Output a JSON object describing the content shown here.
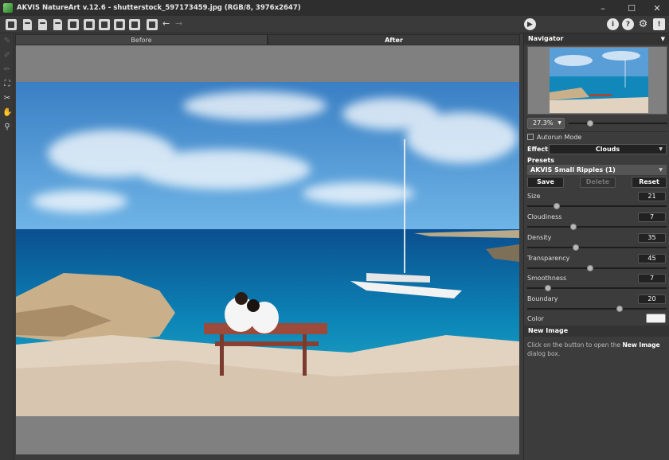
{
  "window": {
    "title": "AKVIS NatureArt v.12.6 - shutterstock_597173459.jpg (RGB/8, 3976x2647)",
    "controls": [
      "minimize",
      "maximize",
      "close"
    ]
  },
  "toolbar": {
    "icons": [
      "workspace-icon",
      "open-icon",
      "save-icon",
      "export-icon",
      "print-icon",
      "batch-icon",
      "plugin-icon",
      "brush-preset-icon",
      "apply-icon",
      "share-icon",
      "undo-icon",
      "redo-icon",
      "run-icon",
      "info-icon",
      "help-icon",
      "settings-icon",
      "notification-icon"
    ]
  },
  "tools": [
    "eraser-icon",
    "brush-icon",
    "pencil-icon",
    "crop-icon",
    "tube-icon",
    "hand-icon",
    "zoom-icon"
  ],
  "tabs": [
    {
      "label": "Before",
      "active": false
    },
    {
      "label": "After",
      "active": true
    }
  ],
  "navigator": {
    "title": "Navigator",
    "zoom": "27.3%",
    "zoom_level": 0.22
  },
  "settings": {
    "autorun_label": "Autorun Mode",
    "autorun_checked": false,
    "effect_label": "Effect:",
    "effect_value": "Clouds",
    "presets_label": "Presets",
    "preset_value": "AKVIS Small Ripples (1)",
    "save_label": "Save",
    "delete_label": "Delete",
    "reset_label": "Reset",
    "params": [
      {
        "label": "Size",
        "value": "21",
        "level": 0.21
      },
      {
        "label": "Cloudiness",
        "value": "7",
        "level": 0.33
      },
      {
        "label": "Density",
        "value": "35",
        "level": 0.35
      },
      {
        "label": "Transparency",
        "value": "45",
        "level": 0.45
      },
      {
        "label": "Smoothness",
        "value": "7",
        "level": 0.15
      },
      {
        "label": "Boundary",
        "value": "20",
        "level": 0.66
      }
    ],
    "color_label": "Color",
    "color_value": "#f4f4f4"
  },
  "help": {
    "title": "New Image",
    "text_before": "Click on the button to open the ",
    "text_bold": "New Image",
    "text_after": " dialog box."
  }
}
